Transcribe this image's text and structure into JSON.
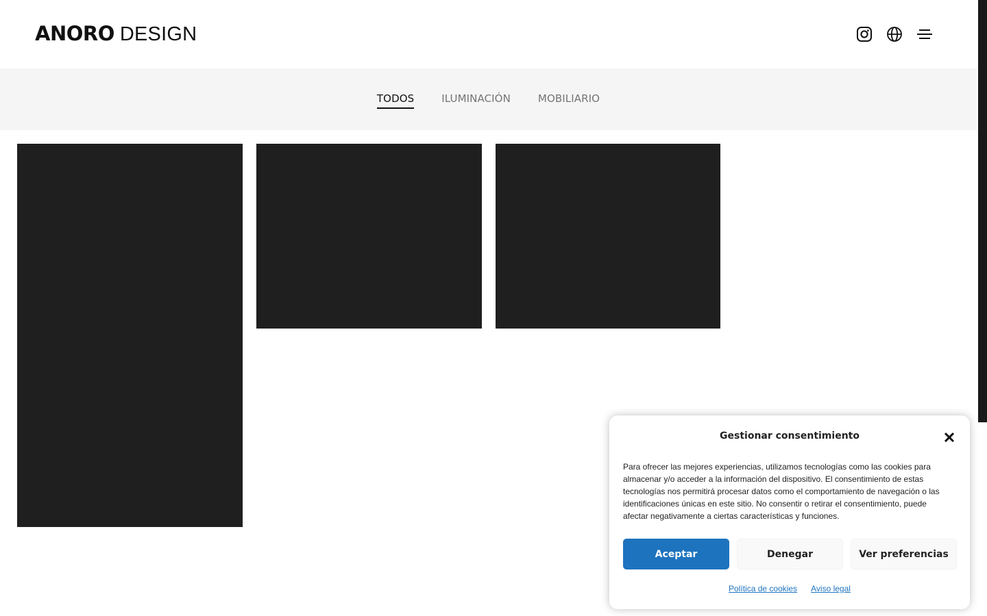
{
  "header": {
    "logo_bold": "ANORO",
    "logo_light": "DESIGN",
    "icons": [
      "instagram-icon",
      "globe-icon",
      "menu-icon"
    ]
  },
  "filters": {
    "items": [
      {
        "label": "TODOS",
        "active": true
      },
      {
        "label": "ILUMINACIÓN",
        "active": false
      },
      {
        "label": "MOBILIARIO",
        "active": false
      }
    ]
  },
  "gallery": {
    "tile_color": "#1f1f1f",
    "tile_count": 3
  },
  "cookie_banner": {
    "title": "Gestionar consentimiento",
    "text": "Para ofrecer las mejores experiencias, utilizamos tecnologías como las cookies para almacenar y/o acceder a la información del dispositivo. El consentimiento de estas tecnologías nos permitirá procesar datos como el comportamiento de navegación o las identificaciones únicas en este sitio. No consentir o retirar el consentimiento, puede afectar negativamente a ciertas características y funciones.",
    "accept_label": "Aceptar",
    "deny_label": "Denegar",
    "preferences_label": "Ver preferencias",
    "cookie_policy_link": "Política de cookies",
    "legal_notice_link": "Aviso legal",
    "accent_color": "#1e73be"
  }
}
